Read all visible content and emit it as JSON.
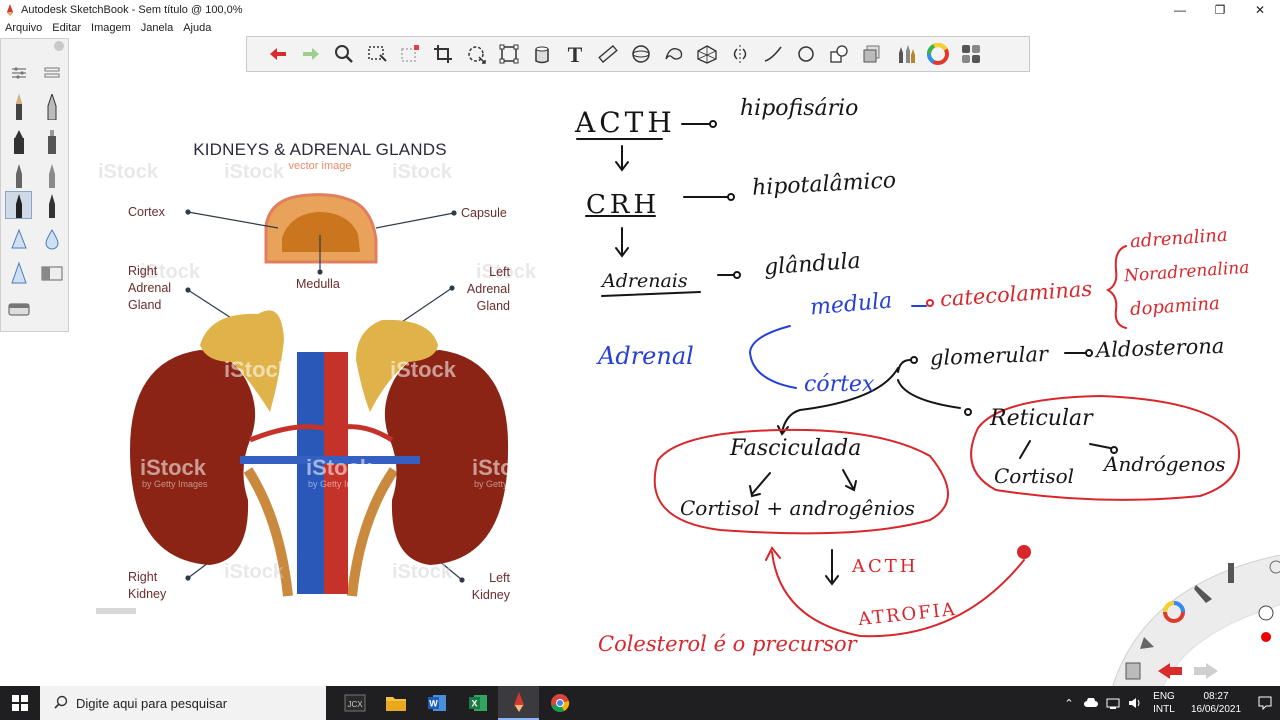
{
  "window": {
    "title": "Autodesk SketchBook - Sem título @ 100,0%",
    "minimize": "—",
    "maximize": "❐",
    "close": "✕"
  },
  "menu": [
    "Arquivo",
    "Editar",
    "Imagem",
    "Janela",
    "Ajuda"
  ],
  "toolbar_icons": [
    "undo-icon",
    "redo-icon",
    "zoom-icon",
    "select-icon",
    "select-rect-icon",
    "crop-icon",
    "transform-icon",
    "distort-icon",
    "fill-icon",
    "text-icon",
    "ruler-icon",
    "ellipse-guide-icon",
    "french-curve-icon",
    "perspective-icon",
    "symmetry-icon",
    "line-icon",
    "circle-icon",
    "shapes-icon",
    "layers-icon",
    "brush-library-icon",
    "color-wheel-icon",
    "copic-color-icon"
  ],
  "image": {
    "title": "KIDNEYS & ADRENAL GLANDS",
    "subtitle": "vector image",
    "labels": {
      "cortex": "Cortex",
      "capsule": "Capsule",
      "medulla": "Medulla",
      "right_adrenal": [
        "Right",
        "Adrenal",
        "Gland"
      ],
      "left_adrenal": [
        "Left",
        "Adrenal",
        "Gland"
      ],
      "right_kidney": [
        "Right",
        "Kidney"
      ],
      "left_kidney": [
        "Left",
        "Kidney"
      ]
    },
    "watermark": "iStock",
    "watermark_sub": "by Getty Images"
  },
  "notes": {
    "acth": "ACTH",
    "hipofisario": "hipofisário",
    "crh": "CRH",
    "hipotalamico": "hipotalâmico",
    "adrenais": "Adrenais",
    "glandula": "glândula",
    "medula": "medula",
    "catecolaminas": "catecolaminas",
    "adrenalina": "adrenalina",
    "noradrenalina": "Noradrenalina",
    "dopamina": "dopamina",
    "adrenal": "Adrenal",
    "cortex": "córtex",
    "glomerular": "glomerular",
    "aldosterona": "Aldosterona",
    "fasciculada": "Fasciculada",
    "cortisol_andro": "Cortisol + androgênios",
    "reticular": "Reticular",
    "cortisol": "Cortisol",
    "androgenos": "Andrógenos",
    "acth2": "ACTH",
    "atrofia": "ATROFIA",
    "colesterol": "Colesterol é o precursor"
  },
  "taskbar": {
    "search_placeholder": "Digite aqui para pesquisar",
    "lang_top": "ENG",
    "lang_bottom": "INTL",
    "time": "08:27",
    "date": "16/06/2021",
    "apps": [
      "sketchup-icon",
      "file-explorer-icon",
      "word-icon",
      "excel-icon",
      "sketchbook-icon",
      "chrome-icon"
    ]
  }
}
